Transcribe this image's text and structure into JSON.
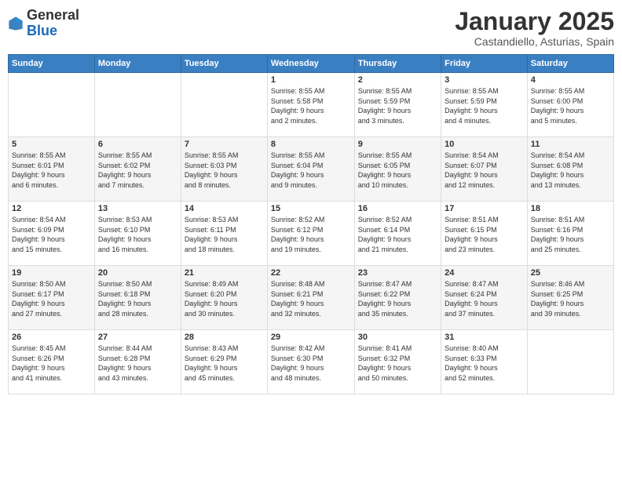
{
  "logo": {
    "general": "General",
    "blue": "Blue"
  },
  "header": {
    "month": "January 2025",
    "location": "Castandiello, Asturias, Spain"
  },
  "weekdays": [
    "Sunday",
    "Monday",
    "Tuesday",
    "Wednesday",
    "Thursday",
    "Friday",
    "Saturday"
  ],
  "weeks": [
    [
      {
        "day": "",
        "info": ""
      },
      {
        "day": "",
        "info": ""
      },
      {
        "day": "",
        "info": ""
      },
      {
        "day": "1",
        "info": "Sunrise: 8:55 AM\nSunset: 5:58 PM\nDaylight: 9 hours\nand 2 minutes."
      },
      {
        "day": "2",
        "info": "Sunrise: 8:55 AM\nSunset: 5:59 PM\nDaylight: 9 hours\nand 3 minutes."
      },
      {
        "day": "3",
        "info": "Sunrise: 8:55 AM\nSunset: 5:59 PM\nDaylight: 9 hours\nand 4 minutes."
      },
      {
        "day": "4",
        "info": "Sunrise: 8:55 AM\nSunset: 6:00 PM\nDaylight: 9 hours\nand 5 minutes."
      }
    ],
    [
      {
        "day": "5",
        "info": "Sunrise: 8:55 AM\nSunset: 6:01 PM\nDaylight: 9 hours\nand 6 minutes."
      },
      {
        "day": "6",
        "info": "Sunrise: 8:55 AM\nSunset: 6:02 PM\nDaylight: 9 hours\nand 7 minutes."
      },
      {
        "day": "7",
        "info": "Sunrise: 8:55 AM\nSunset: 6:03 PM\nDaylight: 9 hours\nand 8 minutes."
      },
      {
        "day": "8",
        "info": "Sunrise: 8:55 AM\nSunset: 6:04 PM\nDaylight: 9 hours\nand 9 minutes."
      },
      {
        "day": "9",
        "info": "Sunrise: 8:55 AM\nSunset: 6:05 PM\nDaylight: 9 hours\nand 10 minutes."
      },
      {
        "day": "10",
        "info": "Sunrise: 8:54 AM\nSunset: 6:07 PM\nDaylight: 9 hours\nand 12 minutes."
      },
      {
        "day": "11",
        "info": "Sunrise: 8:54 AM\nSunset: 6:08 PM\nDaylight: 9 hours\nand 13 minutes."
      }
    ],
    [
      {
        "day": "12",
        "info": "Sunrise: 8:54 AM\nSunset: 6:09 PM\nDaylight: 9 hours\nand 15 minutes."
      },
      {
        "day": "13",
        "info": "Sunrise: 8:53 AM\nSunset: 6:10 PM\nDaylight: 9 hours\nand 16 minutes."
      },
      {
        "day": "14",
        "info": "Sunrise: 8:53 AM\nSunset: 6:11 PM\nDaylight: 9 hours\nand 18 minutes."
      },
      {
        "day": "15",
        "info": "Sunrise: 8:52 AM\nSunset: 6:12 PM\nDaylight: 9 hours\nand 19 minutes."
      },
      {
        "day": "16",
        "info": "Sunrise: 8:52 AM\nSunset: 6:14 PM\nDaylight: 9 hours\nand 21 minutes."
      },
      {
        "day": "17",
        "info": "Sunrise: 8:51 AM\nSunset: 6:15 PM\nDaylight: 9 hours\nand 23 minutes."
      },
      {
        "day": "18",
        "info": "Sunrise: 8:51 AM\nSunset: 6:16 PM\nDaylight: 9 hours\nand 25 minutes."
      }
    ],
    [
      {
        "day": "19",
        "info": "Sunrise: 8:50 AM\nSunset: 6:17 PM\nDaylight: 9 hours\nand 27 minutes."
      },
      {
        "day": "20",
        "info": "Sunrise: 8:50 AM\nSunset: 6:18 PM\nDaylight: 9 hours\nand 28 minutes."
      },
      {
        "day": "21",
        "info": "Sunrise: 8:49 AM\nSunset: 6:20 PM\nDaylight: 9 hours\nand 30 minutes."
      },
      {
        "day": "22",
        "info": "Sunrise: 8:48 AM\nSunset: 6:21 PM\nDaylight: 9 hours\nand 32 minutes."
      },
      {
        "day": "23",
        "info": "Sunrise: 8:47 AM\nSunset: 6:22 PM\nDaylight: 9 hours\nand 35 minutes."
      },
      {
        "day": "24",
        "info": "Sunrise: 8:47 AM\nSunset: 6:24 PM\nDaylight: 9 hours\nand 37 minutes."
      },
      {
        "day": "25",
        "info": "Sunrise: 8:46 AM\nSunset: 6:25 PM\nDaylight: 9 hours\nand 39 minutes."
      }
    ],
    [
      {
        "day": "26",
        "info": "Sunrise: 8:45 AM\nSunset: 6:26 PM\nDaylight: 9 hours\nand 41 minutes."
      },
      {
        "day": "27",
        "info": "Sunrise: 8:44 AM\nSunset: 6:28 PM\nDaylight: 9 hours\nand 43 minutes."
      },
      {
        "day": "28",
        "info": "Sunrise: 8:43 AM\nSunset: 6:29 PM\nDaylight: 9 hours\nand 45 minutes."
      },
      {
        "day": "29",
        "info": "Sunrise: 8:42 AM\nSunset: 6:30 PM\nDaylight: 9 hours\nand 48 minutes."
      },
      {
        "day": "30",
        "info": "Sunrise: 8:41 AM\nSunset: 6:32 PM\nDaylight: 9 hours\nand 50 minutes."
      },
      {
        "day": "31",
        "info": "Sunrise: 8:40 AM\nSunset: 6:33 PM\nDaylight: 9 hours\nand 52 minutes."
      },
      {
        "day": "",
        "info": ""
      }
    ]
  ]
}
